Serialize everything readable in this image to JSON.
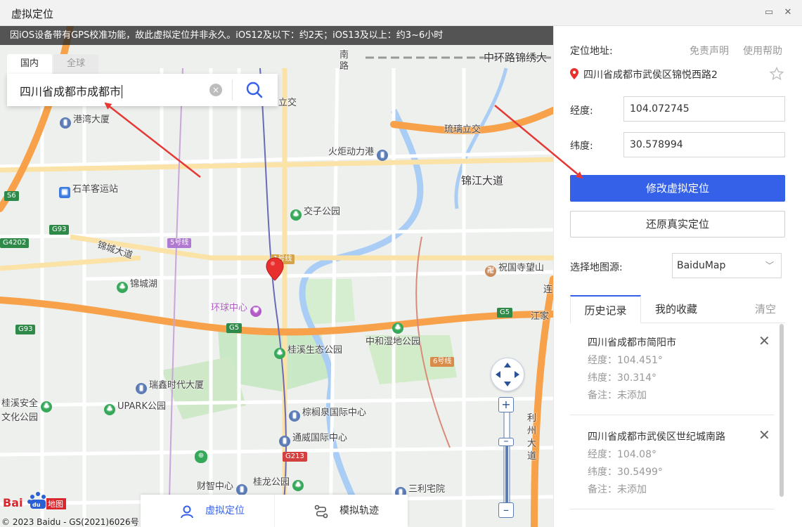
{
  "window": {
    "title": "虚拟定位",
    "restore_icon": "▭",
    "close_icon": "✕"
  },
  "map": {
    "notice": "因iOS设备带有GPS校准功能，故此虚拟定位并非永久。iOS12及以下：约2天；iOS13及以上：约3~6小时",
    "search": {
      "tab_domestic": "国内",
      "tab_global": "全球",
      "value": "四川省成都市成都市",
      "clear_icon": "×"
    },
    "labels": {
      "zhonghuan": "中环路锦绣大",
      "lizhong": "立交",
      "liuli": "琉璃立交",
      "huoju": "火炬动力港",
      "gangwan": "港湾大厦",
      "shiyang": "石羊客运站",
      "jinjiang": "锦江大道",
      "jiaozi": "交子公园",
      "jincheng_dadao": "锦城大道",
      "jincheng_hu": "锦城湖",
      "zhuguo": "祝国寺望山",
      "huanqiu": "环球中心",
      "jiangjia": "江家",
      "zhonghe": "中和湿地公园",
      "guixi": "桂溪生态公园",
      "ruixin": "瑞鑫时代大厦",
      "guixi_anquan_1": "桂溪安全",
      "guixi_anquan_2": "文化公园",
      "upark": "UPARK公园",
      "zonglv": "棕榈泉国际中心",
      "tongwei": "通威国际中心",
      "caizhi": "财智中心",
      "guilong": "桂龙公园",
      "sanli": "三利宅院",
      "nan_road_1": "南",
      "nan_road_2": "路",
      "lian": "连",
      "lizhou": "利州大道",
      "lizhou_1": "利",
      "lizhou_2": "州",
      "lizhou_3": "大",
      "lizhou_4": "道"
    },
    "shields": {
      "s6": "S6",
      "g93_a": "G93",
      "g4202": "G4202",
      "g93_b": "G93",
      "g5_a": "G5",
      "g5_b": "G5",
      "g213": "G213",
      "line5": "5号线",
      "line1": "1号线",
      "line6": "6号线"
    },
    "copyright": "© 2023 Baidu - GS(2021)6026号",
    "logo_text": "Bai  地图",
    "mode_tabs": {
      "virtual": "虚拟定位",
      "track": "模拟轨迹"
    }
  },
  "panel": {
    "address_label": "定位地址:",
    "disclaimer": "免责声明",
    "help": "使用帮助",
    "address": "四川省成都市武侯区锦悦西路2",
    "lng_label": "经度:",
    "lng_value": "104.072745",
    "lat_label": "纬度:",
    "lat_value": "30.578994",
    "modify_button": "修改虚拟定位",
    "restore_button": "还原真实定位",
    "source_label": "选择地图源:",
    "source_value": "BaiduMap",
    "tabs": {
      "history": "历史记录",
      "favorites": "我的收藏",
      "clear": "清空"
    },
    "history": [
      {
        "name": "四川省成都市简阳市",
        "lng": "经度：104.451°",
        "lat": "纬度：30.314°",
        "note": "备注：未添加"
      },
      {
        "name": "四川省成都市武侯区世纪城南路",
        "lng": "经度：104.08°",
        "lat": "纬度：30.5499°",
        "note": "备注：未添加"
      }
    ]
  },
  "colors": {
    "primary": "#3561e8",
    "highway": "#f7a24b",
    "road": "#ffffff",
    "water": "#a9cdf5",
    "park": "#c9e8c5",
    "pin": "#e8312f",
    "arrow": "#e53935"
  }
}
